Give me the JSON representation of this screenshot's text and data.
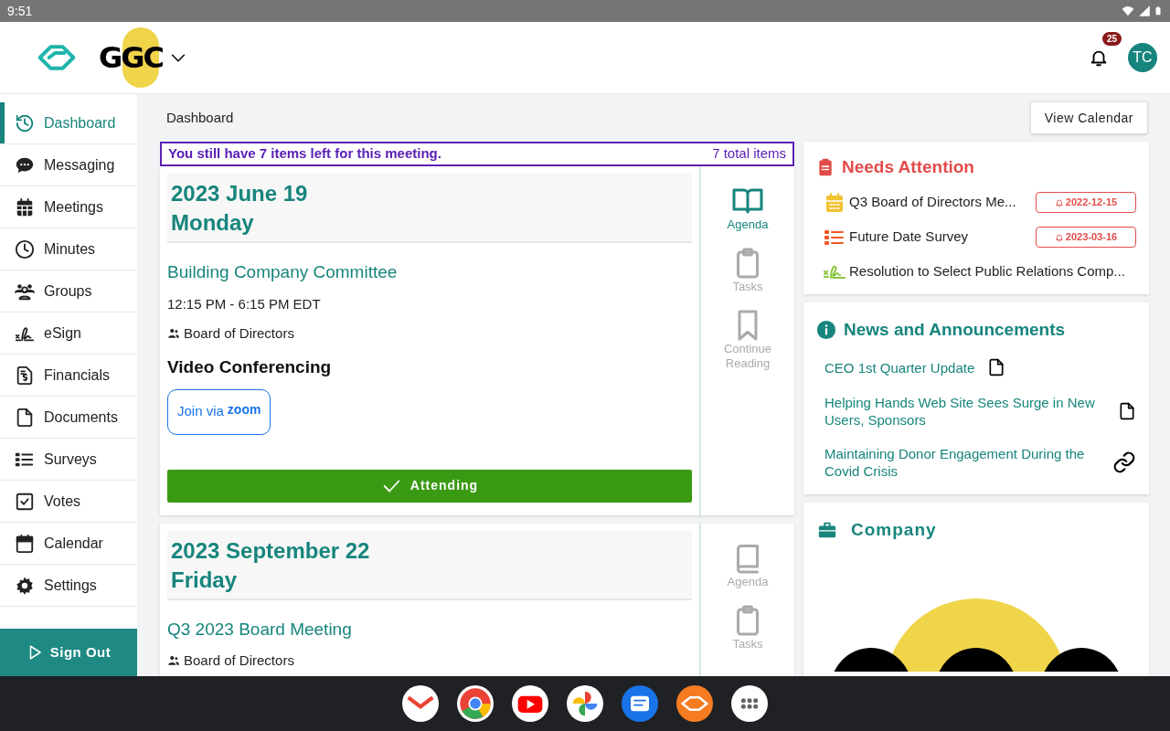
{
  "status_bar": {
    "time": "9:51"
  },
  "header": {
    "logo_text": "GGC",
    "notifications": "25",
    "avatar": "TC"
  },
  "sidebar": {
    "items": [
      {
        "label": "Dashboard",
        "selected": true
      },
      {
        "label": "Messaging",
        "selected": false
      },
      {
        "label": "Meetings",
        "selected": false
      },
      {
        "label": "Minutes",
        "selected": false
      },
      {
        "label": "Groups",
        "selected": false
      },
      {
        "label": "eSign",
        "selected": false
      },
      {
        "label": "Financials",
        "selected": false
      },
      {
        "label": "Documents",
        "selected": false
      },
      {
        "label": "Surveys",
        "selected": false
      },
      {
        "label": "Votes",
        "selected": false
      },
      {
        "label": "Calendar",
        "selected": false
      },
      {
        "label": "Settings",
        "selected": false
      }
    ],
    "sign_out": "Sign Out"
  },
  "page_title": "Dashboard",
  "view_calendar": "View Calendar",
  "banner": {
    "message": "You still have 7 items left for this meeting.",
    "total": "7 total items"
  },
  "meetings": [
    {
      "date": "2023 June 19",
      "weekday": "Monday",
      "title": "Building Company Committee",
      "time": "12:15 PM - 6:15 PM EDT",
      "group": "Board of Directors",
      "video_heading": "Video Conferencing",
      "join_label": "Join via",
      "join_brand": "zoom",
      "attend_label": "Attending",
      "actions": [
        {
          "kind": "agenda",
          "label": "Agenda",
          "enabled": true
        },
        {
          "kind": "tasks",
          "label": "Tasks",
          "enabled": false
        },
        {
          "kind": "bookmark",
          "label": "Continue Reading",
          "enabled": false
        }
      ]
    },
    {
      "date": "2023 September 22",
      "weekday": "Friday",
      "title": "Q3 2023 Board Meeting",
      "group": "Board of Directors",
      "actions": [
        {
          "kind": "book",
          "label": "Agenda",
          "enabled": false
        },
        {
          "kind": "tasks",
          "label": "Tasks",
          "enabled": false
        }
      ]
    }
  ],
  "needs_attention": {
    "title": "Needs Attention",
    "items": [
      {
        "kind": "meeting",
        "label": "Q3 Board of Directors Me...",
        "due": "2022-12-15"
      },
      {
        "kind": "survey",
        "label": "Future Date Survey",
        "due": "2023-03-16"
      },
      {
        "kind": "esign",
        "label": "Resolution to Select Public Relations Comp..."
      }
    ]
  },
  "news": {
    "title": "News and Announcements",
    "items": [
      {
        "kind": "document",
        "label": "CEO 1st Quarter Update"
      },
      {
        "kind": "document",
        "label": "Helping Hands Web Site Sees Surge in New Users, Sponsors"
      },
      {
        "kind": "link",
        "label": "Maintaining Donor Engagement During the Covid Crisis"
      }
    ]
  },
  "company": {
    "title": "Company"
  }
}
